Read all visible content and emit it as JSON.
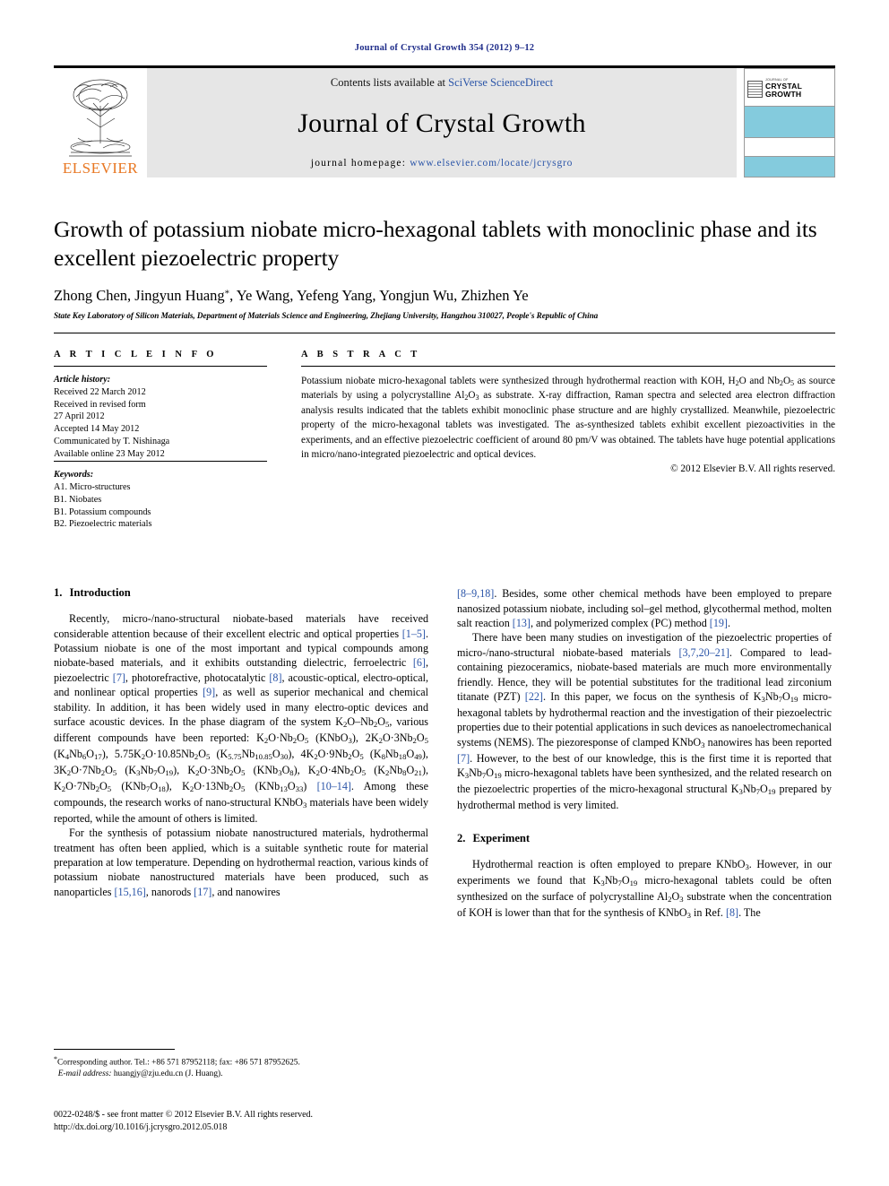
{
  "running_head": "Journal of Crystal Growth 354 (2012) 9–12",
  "masthead": {
    "contents_prefix": "Contents lists available at ",
    "contents_link": "SciVerse ScienceDirect",
    "journal_title": "Journal of Crystal Growth",
    "homepage_prefix": "journal homepage: ",
    "homepage_url": "www.elsevier.com/locate/jcrysgro",
    "publisher_logo_text": "ELSEVIER",
    "cover": {
      "sub": "JOURNAL OF",
      "line1": "CRYSTAL",
      "line2": "GROWTH"
    },
    "link_color": "#2b55a8",
    "elsevier_orange": "#E87722",
    "cover_band_color": "#84cbdd"
  },
  "article": {
    "title": "Growth of potassium niobate micro-hexagonal tablets with monoclinic phase and its excellent piezoelectric property",
    "authors": "Zhong Chen, Jingyun Huang",
    "authors_star": "*",
    "authors_rest": ", Ye Wang, Yefeng Yang, Yongjun Wu, Zhizhen Ye",
    "affiliation": "State Key Laboratory of Silicon Materials, Department of Materials Science and Engineering, Zhejiang University, Hangzhou 310027, People's Republic of China"
  },
  "article_info": {
    "heading": "A R T I C L E   I N F O",
    "history_label": "Article history:",
    "history_lines": [
      "Received 22 March 2012",
      "Received in revised form",
      "27 April 2012",
      "Accepted 14 May 2012",
      "Communicated by T. Nishinaga",
      "Available online 23 May 2012"
    ],
    "keywords_label": "Keywords:",
    "keywords": [
      "A1. Micro-structures",
      "B1. Niobates",
      "B1. Potassium compounds",
      "B2. Piezoelectric materials"
    ]
  },
  "abstract": {
    "heading": "A B S T R A C T",
    "copyright": "© 2012 Elsevier B.V. All rights reserved."
  },
  "sections": {
    "intro_num": "1.",
    "intro_title": "Introduction",
    "exp_num": "2.",
    "exp_title": "Experiment"
  },
  "footnote": {
    "corresponding": "Corresponding author. Tel.: +86 571 87952118; fax: +86 571 87952625.",
    "email_label": "E-mail address:",
    "email": "huangjy@zju.edu.cn (J. Huang)."
  },
  "footer": {
    "issn_line": "0022-0248/$ - see front matter © 2012 Elsevier B.V. All rights reserved.",
    "doi_line": "http://dx.doi.org/10.1016/j.jcrysgro.2012.05.018"
  }
}
